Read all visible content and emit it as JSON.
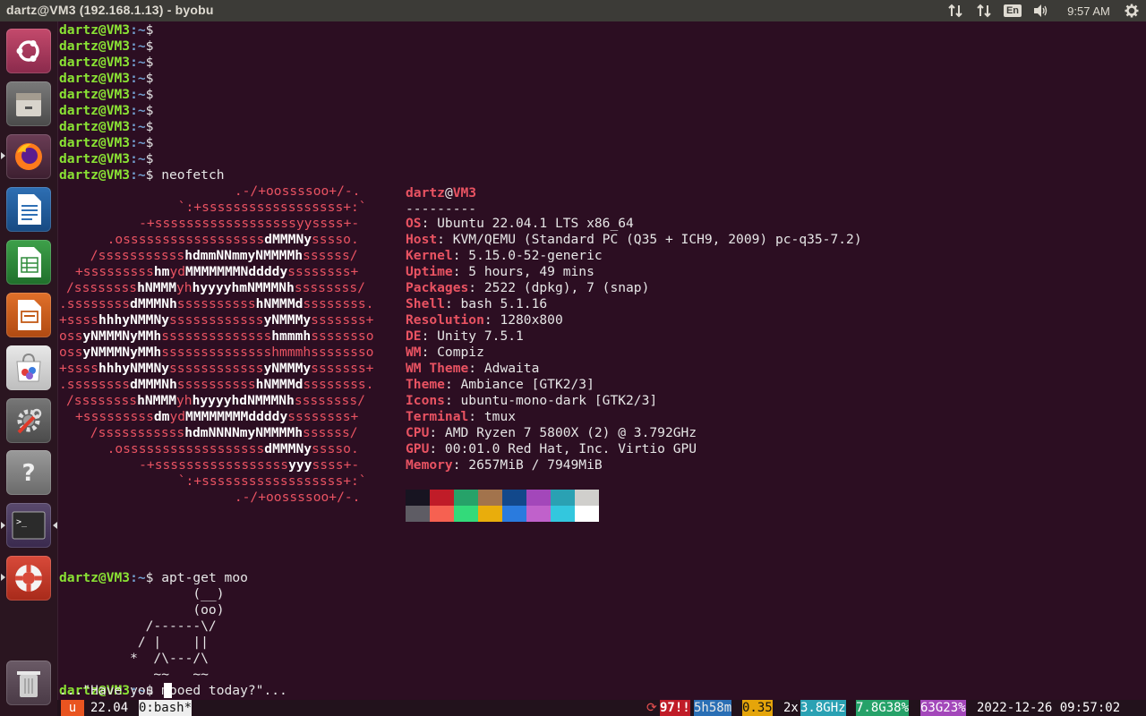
{
  "window": {
    "title": "dartz@VM3 (192.168.1.13) - byobu"
  },
  "panel": {
    "keyboard_layout": "En",
    "clock": "9:57 AM",
    "icons": [
      "network-up-down-icon",
      "network-up-down-icon",
      "keyboard-layout-icon",
      "volume-icon",
      "gear-icon"
    ]
  },
  "launcher": {
    "items": [
      "ubuntu-dash-icon",
      "files-icon",
      "firefox-icon",
      "libreoffice-writer-icon",
      "libreoffice-calc-icon",
      "libreoffice-impress-icon",
      "software-center-icon",
      "system-settings-icon",
      "help-icon",
      "terminal-icon",
      "ubuntu-one-icon",
      "trash-icon"
    ]
  },
  "terminal": {
    "prompt_user": "dartz@VM3",
    "prompt_path": ":~",
    "prompt_symbol": "$",
    "cmd_neofetch": " neofetch",
    "cmd_moo": " apt-get moo",
    "logo": [
      [
        "          .-/+oossssoo+/-."
      ],
      [
        "      `:+ssssssssssssssssss+:`"
      ],
      [
        "    -+ssssssssssssssssssyyssss+-"
      ],
      [
        "  .ossssssssssssssssss",
        "dMMMNy",
        "sssso."
      ],
      [
        " /sssssssssss",
        "hdmmNNmmyNMMMMh",
        "ssssss/"
      ],
      [
        "+sssssssss",
        "hm",
        "yd",
        "MMMMMMMNddddy",
        "ssssssss+"
      ],
      [
        "/ssssssss",
        "hNMMM",
        "yh",
        "hyyyyhmNMMMNh",
        "ssssssss/"
      ],
      [
        ".ssssssss",
        "dMMMNh",
        "ssssssssss",
        "hNMMMd",
        "ssssssss."
      ],
      [
        "+ssss",
        "hhhyNMMNy",
        "ssssssssssss",
        "yNMMMy",
        "sssssss+"
      ],
      [
        "oss",
        "yNMMMNyMMh",
        "ssssssssssssss",
        "hmmmh",
        "ssssssso"
      ],
      [
        "oss",
        "yNMMMNyMMh",
        "sssssssssssssshmmmhssssssso"
      ],
      [
        "+ssss",
        "hhhyNMMNy",
        "ssssssssssss",
        "yNMMMy",
        "sssssss+"
      ],
      [
        ".ssssssss",
        "dMMMNh",
        "ssssssssss",
        "hNMMMd",
        "ssssssss."
      ],
      [
        "/ssssssss",
        "hNMMM",
        "yh",
        "hyyyyhdNMMMNh",
        "ssssssss/"
      ],
      [
        "+sssssssss",
        "dm",
        "yd",
        "MMMMMMMMddddy",
        "ssssssss+"
      ],
      [
        " /sssssssssss",
        "hdmNNNNmyNMMMMh",
        "ssssss/"
      ],
      [
        "  .ossssssssssssssssss",
        "dMMMNy",
        "sssso."
      ],
      [
        "    -+sssssssssssssssss",
        "yyy",
        "ssss+-"
      ],
      [
        "      `:+ssssssssssssssssss+:`"
      ],
      [
        "          .-/+oossssoo+/-."
      ]
    ],
    "info": {
      "user": "dartz",
      "at": "@",
      "host": "VM3",
      "separator": "---------",
      "rows": [
        {
          "key": "OS",
          "value": ": Ubuntu 22.04.1 LTS x86_64"
        },
        {
          "key": "Host",
          "value": ": KVM/QEMU (Standard PC (Q35 + ICH9, 2009) pc-q35-7.2)"
        },
        {
          "key": "Kernel",
          "value": ": 5.15.0-52-generic"
        },
        {
          "key": "Uptime",
          "value": ": 5 hours, 49 mins"
        },
        {
          "key": "Packages",
          "value": ": 2522 (dpkg), 7 (snap)"
        },
        {
          "key": "Shell",
          "value": ": bash 5.1.16"
        },
        {
          "key": "Resolution",
          "value": ": 1280x800"
        },
        {
          "key": "DE",
          "value": ": Unity 7.5.1"
        },
        {
          "key": "WM",
          "value": ": Compiz"
        },
        {
          "key": "WM Theme",
          "value": ": Adwaita"
        },
        {
          "key": "Theme",
          "value": ": Ambiance [GTK2/3]"
        },
        {
          "key": "Icons",
          "value": ": ubuntu-mono-dark [GTK2/3]"
        },
        {
          "key": "Terminal",
          "value": ": tmux"
        },
        {
          "key": "CPU",
          "value": ": AMD Ryzen 7 5800X (2) @ 3.792GHz"
        },
        {
          "key": "GPU",
          "value": ": 00:01.0 Red Hat, Inc. Virtio GPU"
        },
        {
          "key": "Memory",
          "value": ": 2657MiB / 7949MiB"
        }
      ]
    },
    "palette_top": [
      "#171421",
      "#c01c28",
      "#26a269",
      "#a2734c",
      "#12488b",
      "#a347ba",
      "#2aa1b3",
      "#d0cfcc"
    ],
    "palette_bottom": [
      "#5e5c64",
      "#f66151",
      "#33da7a",
      "#e9ad0c",
      "#2a7bde",
      "#c061cb",
      "#33c7de",
      "#ffffff"
    ],
    "cow": [
      "                 (__)",
      "                 (oo)",
      "           /------\\/",
      "          / |    ||",
      "         *  /\\---/\\",
      "            ~~   ~~",
      "...\"Have you mooed today?\"..."
    ]
  },
  "statusbar": {
    "logo": "u",
    "release": "22.04",
    "window": "0:bash*",
    "updates": "97!!",
    "uptime": "5h58m",
    "load": "0.35",
    "cpu_count": "2x",
    "cpu_freq": "3.8GHz",
    "mem": "7.8G38%",
    "disk": "63G23%",
    "datetime": "2022-12-26 09:57:02"
  }
}
